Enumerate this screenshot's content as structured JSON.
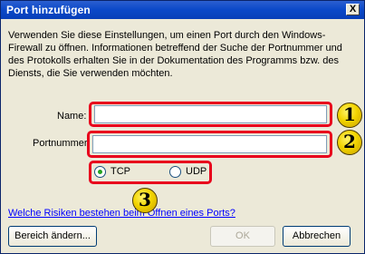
{
  "window": {
    "title": "Port hinzufügen",
    "close_glyph": "X"
  },
  "description": "Verwenden Sie diese Einstellungen, um einen Port durch den Windows-Firewall zu öffnen. Informationen betreffend der Suche der Portnummer und des Protokolls erhalten Sie in der Dokumentation des Programms bzw. des Diensts, die Sie verwenden möchten.",
  "form": {
    "name_label": "Name:",
    "name_value": "",
    "port_label": "Portnummer:",
    "port_value": "",
    "protocol_options": [
      {
        "label": "TCP",
        "selected": true
      },
      {
        "label": "UDP",
        "selected": false
      }
    ]
  },
  "annotations": [
    "1",
    "2",
    "3"
  ],
  "risk_link": "Welche Risiken bestehen beim Öffnen eines Ports?",
  "buttons": {
    "change_scope": "Bereich ändern...",
    "ok": "OK",
    "cancel": "Abbrechen"
  },
  "colors": {
    "highlight": "#e8001c",
    "badge": "#f2d400",
    "titlebar": "#0a48c8"
  }
}
